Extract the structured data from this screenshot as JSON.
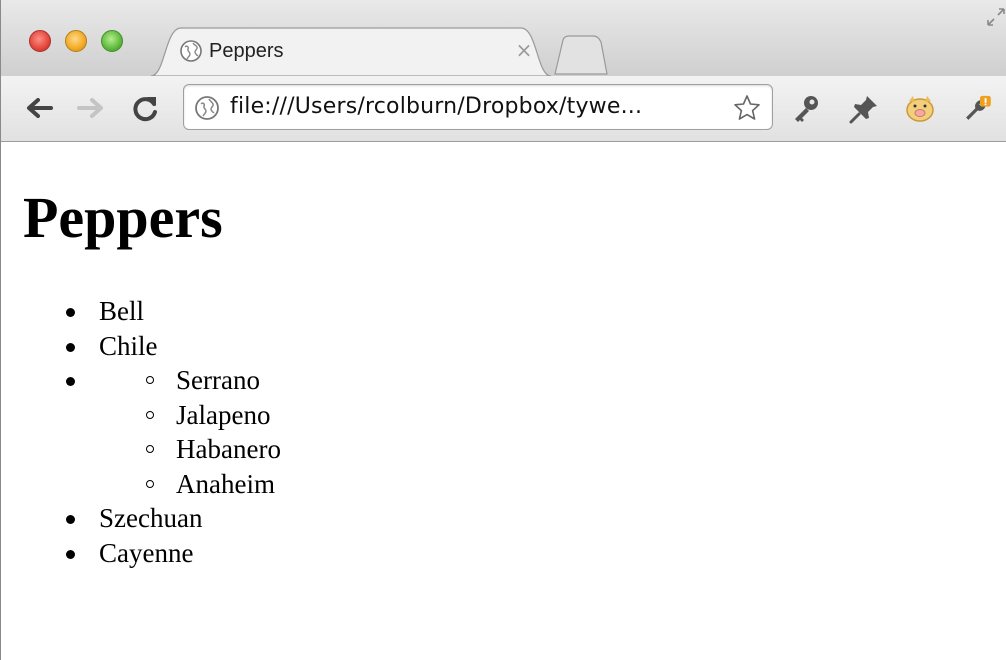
{
  "window": {
    "tab": {
      "title": "Peppers"
    },
    "toolbar": {
      "url": "file:///Users/rcolburn/Dropbox/tywe..."
    },
    "icons": {
      "close": "close-window-icon",
      "minimize": "minimize-window-icon",
      "maximize": "maximize-window-icon",
      "back": "back-arrow-icon",
      "forward": "forward-arrow-icon",
      "reload": "reload-icon",
      "bookmark": "star-icon",
      "tab_close": "×"
    }
  },
  "page": {
    "heading": "Peppers",
    "list": [
      {
        "text": "Bell"
      },
      {
        "text": "Chile"
      },
      {
        "text": "",
        "children": [
          "Serrano",
          "Jalapeno",
          "Habanero",
          "Anaheim"
        ]
      },
      {
        "text": "Szechuan"
      },
      {
        "text": "Cayenne"
      }
    ]
  },
  "colors": {
    "close": "#e2463b",
    "minimize": "#f2a922",
    "maximize": "#5cba3c",
    "badge": "#f0a020"
  }
}
